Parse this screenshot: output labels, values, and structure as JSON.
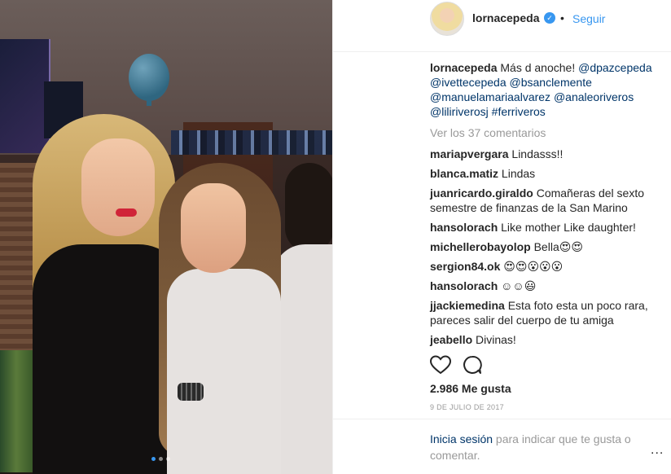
{
  "post": {
    "photo_alt": "Foto de fiesta",
    "carousel": {
      "count": 3,
      "active": 1
    }
  },
  "header": {
    "username": "lornacepeda",
    "verified_glyph": "✓",
    "separator": "•",
    "follow_label": "Seguir"
  },
  "caption": {
    "username": "lornacepeda",
    "text": "Más d anoche!",
    "tags": [
      "@dpazcepeda",
      "@ivettecepeda",
      "@bsanclemente",
      "@manuelamariaalvarez",
      "@analeoriveros",
      "@liliriverosj",
      "#ferriveros"
    ]
  },
  "view_comments": "Ver los 37 comentarios",
  "comments": [
    {
      "user": "mariapvergara",
      "text": "Lindasss!!"
    },
    {
      "user": "blanca.matiz",
      "text": "Lindas"
    },
    {
      "user": "juanricardo.giraldo",
      "text": "Comañeras del sexto semestre de finanzas de la San Marino"
    },
    {
      "user": "hansolorach",
      "text": "Like mother Like daughter!"
    },
    {
      "user": "michellerobayolop",
      "text": "Bella😍😍"
    },
    {
      "user": "sergion84.ok",
      "text": "😍😍😮😮😮"
    },
    {
      "user": "hansolorach",
      "text": "☺☺😃"
    },
    {
      "user": "jjackiemedina",
      "text": "Esta foto esta un poco rara, pareces salir del cuerpo de tu amiga"
    },
    {
      "user": "jeabello",
      "text": "Divinas!"
    }
  ],
  "actions": {
    "like_icon": "heart-icon",
    "comment_icon": "comment-icon"
  },
  "likes": "2.986 Me gusta",
  "date": "9 DE JULIO DE 2017",
  "login": {
    "link": "Inicia sesión",
    "text": " para indicar que te gusta o comentar."
  },
  "more_options": "...",
  "colors": {
    "link": "#003569",
    "accent": "#3897f0",
    "muted": "#999999",
    "text": "#262626"
  }
}
